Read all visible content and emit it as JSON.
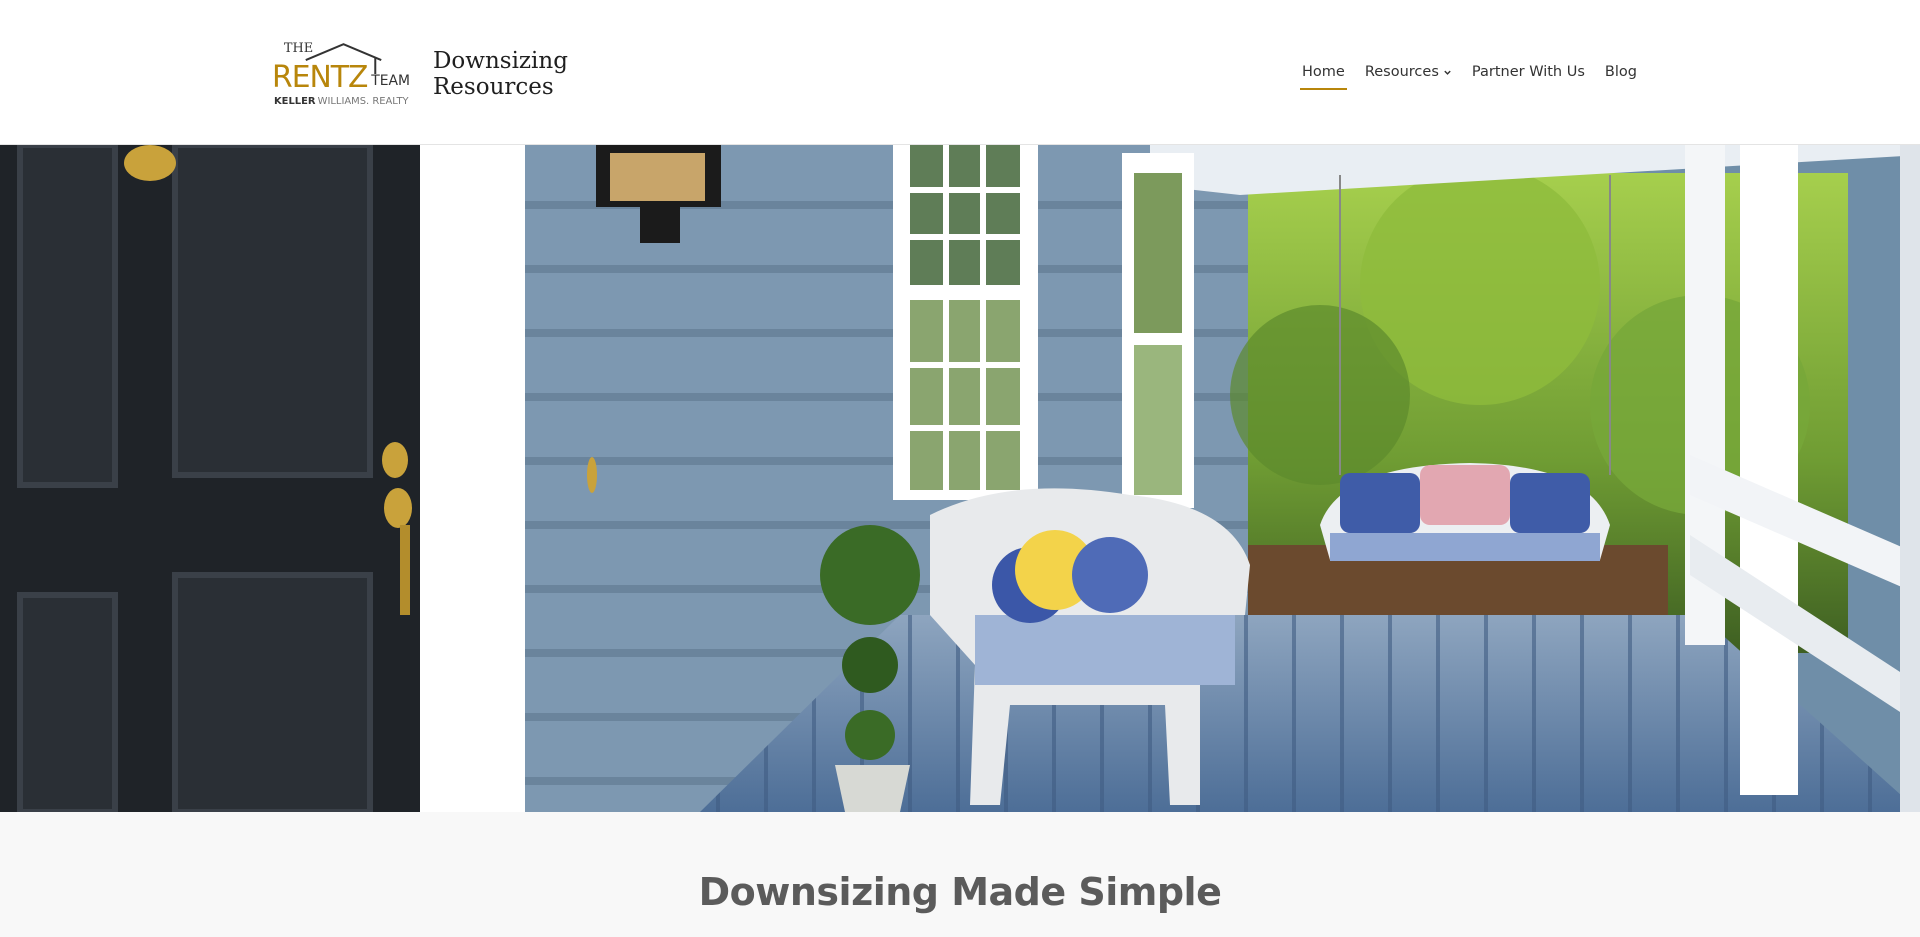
{
  "brand": {
    "logo": {
      "top_word": "THE",
      "main_word": "RENTZ",
      "side_word": "TEAM",
      "sub_bold": "KELLER",
      "sub_light": "WILLIAMS. REALTY",
      "gold": "#b8860b"
    },
    "site_name": "Downsizing\nResources"
  },
  "nav": {
    "items": [
      {
        "label": "Home",
        "active": true,
        "has_dropdown": false
      },
      {
        "label": "Resources",
        "active": false,
        "has_dropdown": true
      },
      {
        "label": "Partner With Us",
        "active": false,
        "has_dropdown": false
      },
      {
        "label": "Blog",
        "active": false,
        "has_dropdown": false
      }
    ],
    "accent_color": "#b8860b"
  },
  "hero": {
    "image_subject": "front porch with black door, blue siding, white wicker loveseat, porch swing and garden"
  },
  "intro": {
    "title": "Downsizing Made Simple"
  }
}
